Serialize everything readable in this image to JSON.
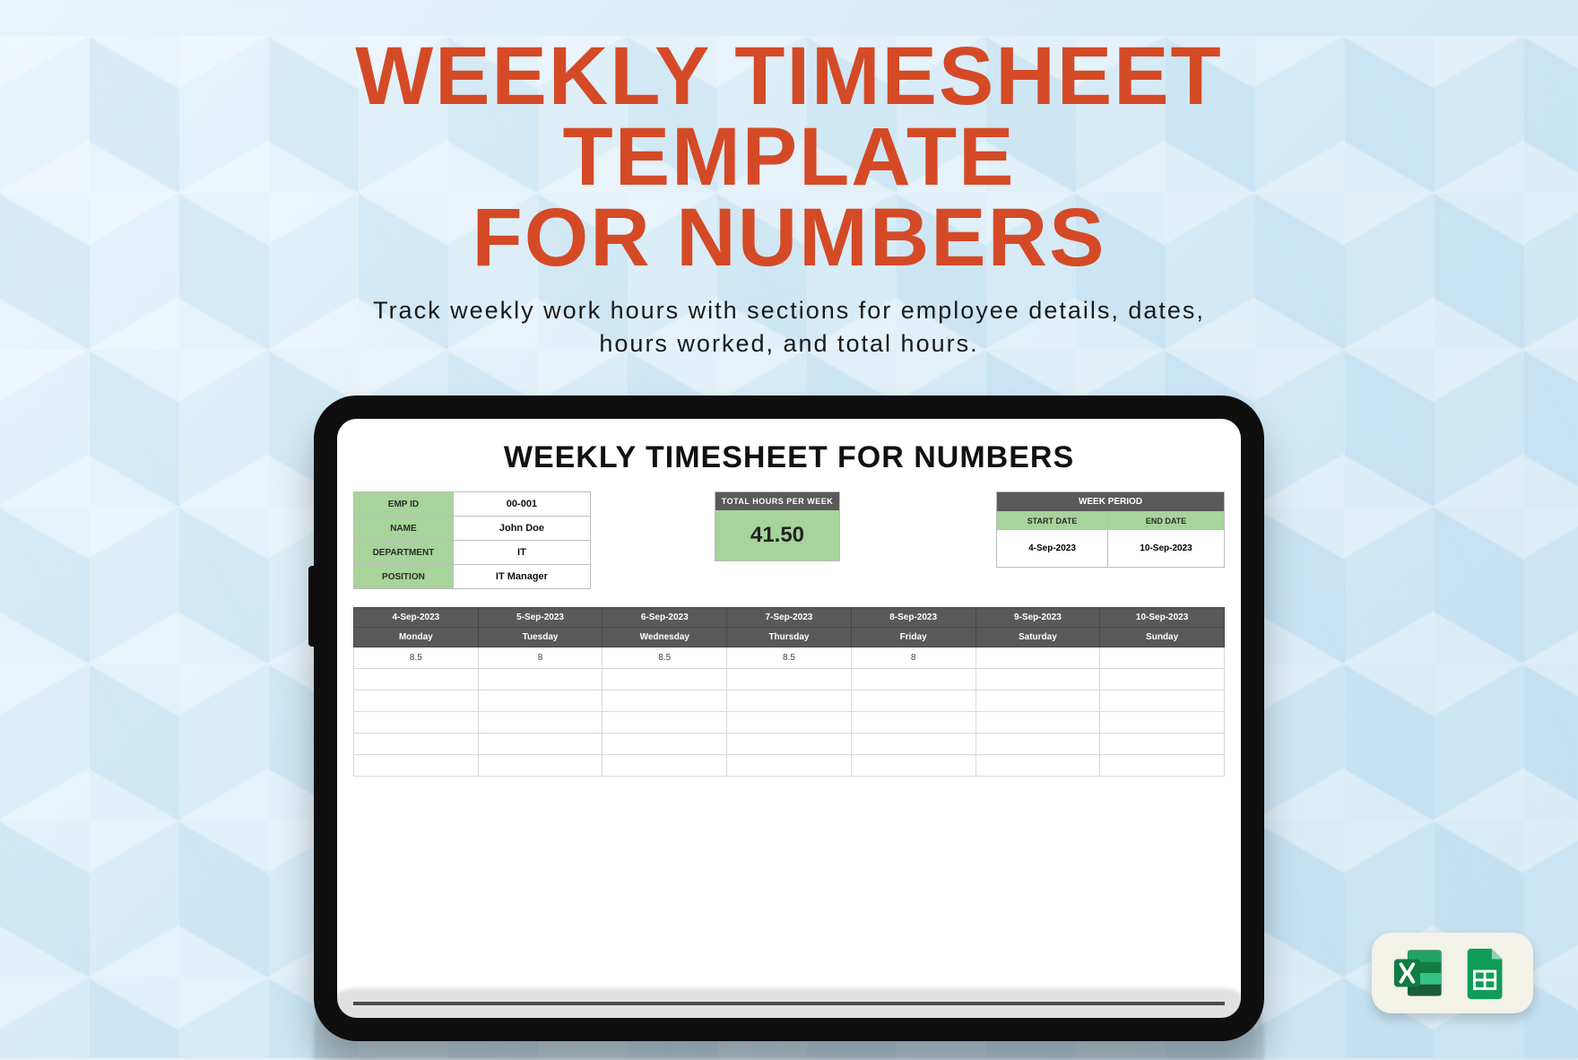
{
  "hero": {
    "line1": "WEEKLY TIMESHEET",
    "line2": "TEMPLATE",
    "line3": "FOR NUMBERS",
    "subtitle1": "Track weekly work hours with sections for employee details, dates,",
    "subtitle2": "hours worked, and total hours."
  },
  "sheet": {
    "title": "WEEKLY TIMESHEET FOR NUMBERS",
    "employee": {
      "emp_id_label": "EMP ID",
      "emp_id": "00-001",
      "name_label": "NAME",
      "name": "John Doe",
      "dept_label": "DEPARTMENT",
      "dept": "IT",
      "position_label": "POSITION",
      "position": "IT Manager"
    },
    "total": {
      "label": "TOTAL  HOURS PER WEEK",
      "value": "41.50"
    },
    "week_period": {
      "header": "WEEK PERIOD",
      "start_label": "START DATE",
      "end_label": "END DATE",
      "start": "4-Sep-2023",
      "end": "10-Sep-2023"
    },
    "columns": [
      {
        "date": "4-Sep-2023",
        "day": "Monday",
        "hours": "8.5"
      },
      {
        "date": "5-Sep-2023",
        "day": "Tuesday",
        "hours": "8"
      },
      {
        "date": "6-Sep-2023",
        "day": "Wednesday",
        "hours": "8.5"
      },
      {
        "date": "7-Sep-2023",
        "day": "Thursday",
        "hours": "8.5"
      },
      {
        "date": "8-Sep-2023",
        "day": "Friday",
        "hours": "8"
      },
      {
        "date": "9-Sep-2023",
        "day": "Saturday",
        "hours": ""
      },
      {
        "date": "10-Sep-2023",
        "day": "Sunday",
        "hours": ""
      }
    ]
  },
  "icons": {
    "excel": "excel-icon",
    "sheets": "google-sheets-icon"
  }
}
